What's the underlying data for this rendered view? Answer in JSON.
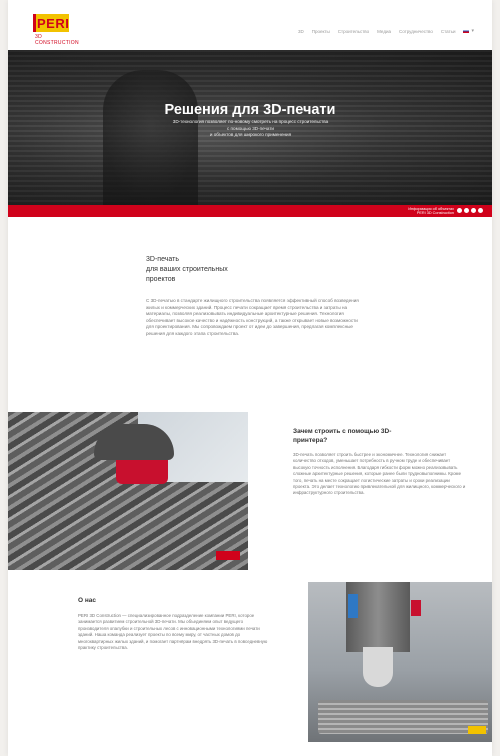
{
  "brand": {
    "logo_text": "PERI",
    "logo_subtext": "3D CONSTRUCTION",
    "colors": {
      "red": "#d0021b",
      "yellow": "#f2c200"
    }
  },
  "nav": {
    "items": [
      "3D",
      "Проекты",
      "Строительство",
      "Медиа",
      "Сотрудничество",
      "Статьи"
    ],
    "language": "RU"
  },
  "hero": {
    "title": "Решения для 3D-печати",
    "subtitle_line1": "3D-технология позволяет по-новому смотреть на процесс строительства",
    "subtitle_line2": "с помощью 3D-печати",
    "subtitle_line3": "и объектов для широкого применения"
  },
  "redbar": {
    "line1": "Информация об объектах",
    "line2": "PERI 3D Construction"
  },
  "section1": {
    "title_line1": "3D-печать",
    "title_line2": "для ваших строительных",
    "title_line3": "проектов",
    "body": "С 3D-печатью в стандарте жилищного строительства появляется эффективный способ возведения жилых и коммерческих зданий. Процесс печати сокращает время строительства и затраты на материалы, позволяя реализовывать индивидуальные архитектурные решения. Технология обеспечивает высокое качество и надёжность конструкций, а также открывает новые возможности для проектирования. Мы сопровождаем проект от идеи до завершения, предлагая комплексные решения для каждого этапа строительства."
  },
  "section2": {
    "title_line1": "Зачем строить с помощью 3D-",
    "title_line2": "принтера?",
    "body": "3D-печать позволяет строить быстрее и экономичнее. Технология снижает количество отходов, уменьшает потребность в ручном труде и обеспечивает высокую точность исполнения. Благодаря гибкости форм можно реализовывать сложные архитектурные решения, которые ранее были трудновыполнимы. Кроме того, печать на месте сокращает логистические затраты и сроки реализации проекта. Это делает технологию привлекательной для жилищного, коммерческого и инфраструктурного строительства."
  },
  "section3": {
    "title": "О нас",
    "body": "PERI 3D Construction — специализированное подразделение компании PERI, которое занимается развитием строительной 3D-печати. Мы объединяем опыт ведущего производителя опалубки и строительных лесов с инновационными технологиями печати зданий. Наша команда реализует проекты по всему миру, от частных домов до многоквартирных жилых зданий, и помогает партнёрам внедрять 3D-печать в повседневную практику строительства."
  }
}
